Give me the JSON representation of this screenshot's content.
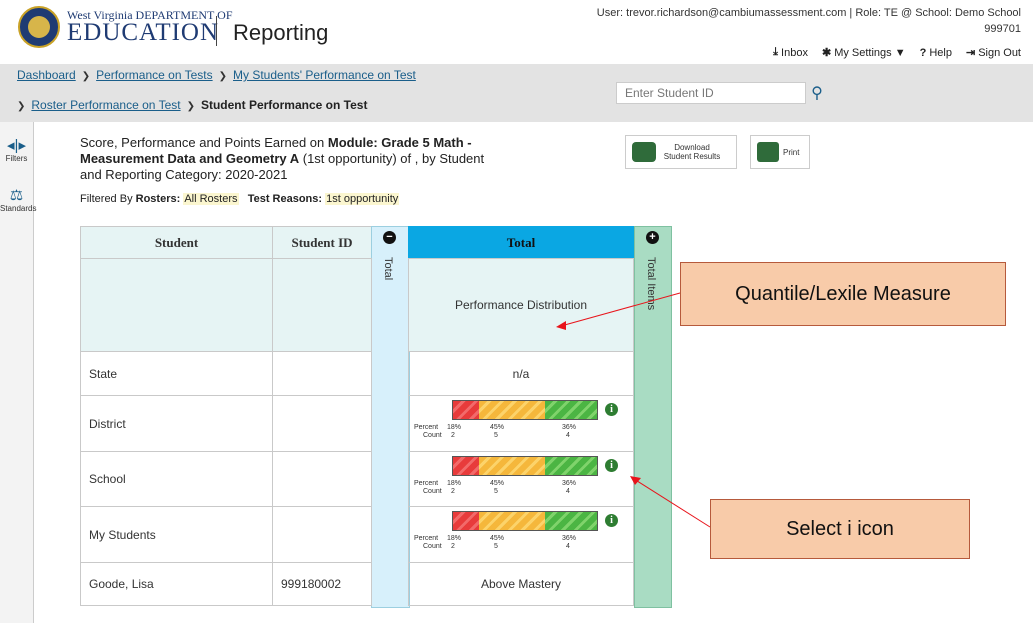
{
  "header": {
    "logo_small": "West Virginia DEPARTMENT OF",
    "logo_big": "EDUCATION",
    "app_title": "Reporting",
    "user_info": "User: trevor.richardson@cambiumassessment.com  |  Role: TE @ School: Demo School",
    "school_id": "999701",
    "links": [
      {
        "icon": "inbox-icon",
        "glyph": "⤓",
        "label": "Inbox"
      },
      {
        "icon": "gear-icon",
        "glyph": "✱",
        "label": "My Settings ▼"
      },
      {
        "icon": "help-icon",
        "glyph": "?",
        "label": "Help"
      },
      {
        "icon": "sign-out-icon",
        "glyph": "⇥",
        "label": "Sign Out"
      }
    ]
  },
  "breadcrumb": {
    "items": [
      "Dashboard",
      "Performance on Tests",
      "My Students' Performance on Test",
      "Roster Performance on Test"
    ],
    "current": "Student Performance on Test"
  },
  "search": {
    "placeholder": "Enter Student ID"
  },
  "rail": {
    "filters": "Filters",
    "standards": "Standards"
  },
  "report": {
    "title_pre": "Score, Performance and Points Earned on ",
    "title_bold": "Module: Grade 5 Math - Measurement Data and Geometry A",
    "title_post": " (1st opportunity) of , by Student and Reporting Category: 2020-2021",
    "filtered_by": "Filtered By",
    "rosters_label": "Rosters:",
    "rosters_value": "All Rosters",
    "reasons_label": "Test Reasons:",
    "reasons_value": "1st opportunity",
    "download_label": "Download Student Results",
    "print_label": "Print"
  },
  "table": {
    "col_student": "Student",
    "col_student_id": "Student ID",
    "col_total_v": "Total",
    "col_total": "Total",
    "col_total_items": "Total Items",
    "perf_dist": "Performance Distribution",
    "rows": [
      {
        "label": "State",
        "id": "",
        "value": "n/a"
      },
      {
        "label": "District",
        "id": ""
      },
      {
        "label": "School",
        "id": ""
      },
      {
        "label": "My Students",
        "id": ""
      },
      {
        "label": "Goode, Lisa",
        "id": "999180002",
        "value": "Above Mastery"
      }
    ],
    "dist": {
      "percent_label": "Percent",
      "count_label": "Count",
      "percents": [
        "18%",
        "45%",
        "36%"
      ],
      "counts": [
        "2",
        "5",
        "4"
      ],
      "fractions": [
        0.18,
        0.45,
        0.36
      ]
    }
  },
  "callouts": {
    "quantile": "Quantile/Lexile Measure",
    "info": "Select i icon"
  },
  "colors": {
    "accent": "#0aa7e3",
    "items": "#a9dcc3",
    "callout": "#f8cba9",
    "arrow": "#e8141b"
  }
}
